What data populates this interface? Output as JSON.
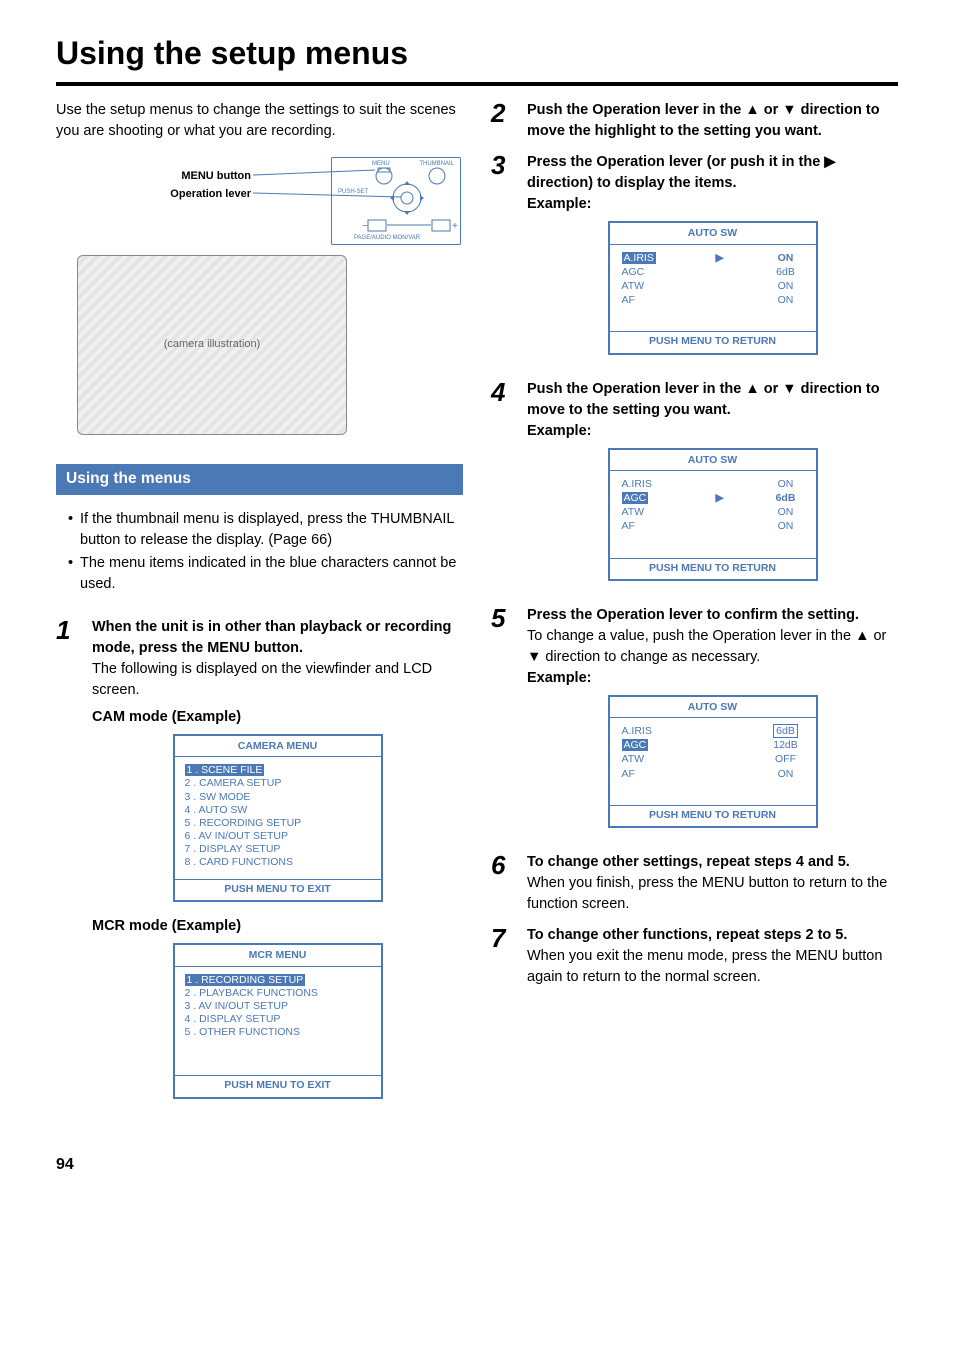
{
  "page_title": "Using the setup menus",
  "intro": "Use the setup menus to change the settings to suit the scenes you are shooting or what you are recording.",
  "diagram": {
    "label_menu_button": "MENU button",
    "label_operation_lever": "Operation lever",
    "panel_menu": "MENU",
    "panel_thumbnail": "THUMBNAIL",
    "panel_pushset": "PUSH-SET",
    "panel_pageaudio": "PAGE/AUDIO MON/VAR",
    "camera_placeholder": "(camera illustration)"
  },
  "section_using_menus": "Using the menus",
  "bullets": [
    "If the thumbnail menu is displayed, press the THUMBNAIL button to release the display. (Page 66)",
    "The menu items indicated in the blue characters cannot be used."
  ],
  "step1": {
    "head": "When the unit is in other than playback or recording mode, press the MENU button.",
    "body": "The following is displayed on the viewfinder and LCD screen.",
    "cam_label": "CAM mode (Example)",
    "mcr_label": "MCR mode (Example)"
  },
  "camera_menu": {
    "title": "CAMERA MENU",
    "highlight": "1 . SCENE FILE",
    "items": [
      "2 . CAMERA SETUP",
      "3 . SW MODE",
      "4 . AUTO SW",
      "5 . RECORDING SETUP",
      "6 . AV IN/OUT SETUP",
      "7 . DISPLAY SETUP",
      "8 . CARD FUNCTIONS"
    ],
    "footer": "PUSH MENU TO EXIT"
  },
  "mcr_menu": {
    "title": "MCR MENU",
    "highlight": "1 . RECORDING SETUP",
    "items": [
      "2 . PLAYBACK FUNCTIONS",
      "3 . AV IN/OUT SETUP",
      "4 . DISPLAY SETUP",
      "5 . OTHER FUNCTIONS"
    ],
    "footer": "PUSH MENU TO EXIT"
  },
  "step2": {
    "head_a": "Push the Operation lever in the ",
    "head_b": " or ",
    "head_c": " direction to move the highlight to the setting you want."
  },
  "step3": {
    "head_a": "Press the Operation lever (or push it in the ",
    "head_b": " direction) to display the items.",
    "example": "Example:"
  },
  "auto_sw_title": "AUTO SW",
  "auto_sw_footer": "PUSH  MENU TO RETURN",
  "autosw3": {
    "rows": [
      {
        "label": "A.IRIS",
        "arrow": "▶",
        "val": "ON",
        "label_hl": true,
        "val_bold": true
      },
      {
        "label": "AGC",
        "arrow": "",
        "val": "6dB"
      },
      {
        "label": "ATW",
        "arrow": "",
        "val": "ON"
      },
      {
        "label": "AF",
        "arrow": "",
        "val": "ON"
      }
    ]
  },
  "step4": {
    "head_a": "Push the Operation lever in the ",
    "head_b": " or ",
    "head_c": " direction to move to the setting you want.",
    "example": "Example:"
  },
  "autosw4": {
    "rows": [
      {
        "label": "A.IRIS",
        "arrow": "",
        "val": "ON"
      },
      {
        "label": "AGC",
        "arrow": "▶",
        "val": "6dB",
        "label_hl": true,
        "val_bold": true
      },
      {
        "label": "ATW",
        "arrow": "",
        "val": "ON"
      },
      {
        "label": "AF",
        "arrow": "",
        "val": "ON"
      }
    ]
  },
  "step5": {
    "head": "Press the Operation lever to confirm the setting.",
    "body_a": "To change a value, push the Operation lever in the ",
    "body_b": " or ",
    "body_c": " direction to change as necessary.",
    "example": "Example:"
  },
  "autosw5": {
    "rows": [
      {
        "label": "A.IRIS",
        "arrow": "",
        "val": "6dB",
        "val_box": true
      },
      {
        "label": "AGC",
        "arrow": "",
        "val": "12dB",
        "label_hl": true
      },
      {
        "label": "ATW",
        "arrow": "",
        "val": "OFF"
      },
      {
        "label": "AF",
        "arrow": "",
        "val": "ON"
      }
    ]
  },
  "step6": {
    "head": "To change other settings, repeat steps 4 and 5.",
    "body": "When you finish, press the MENU button to return to the function screen."
  },
  "step7": {
    "head": "To change other functions, repeat steps 2 to 5.",
    "body": "When you exit the menu mode, press the MENU button again to return to the normal screen."
  },
  "page_number": "94"
}
